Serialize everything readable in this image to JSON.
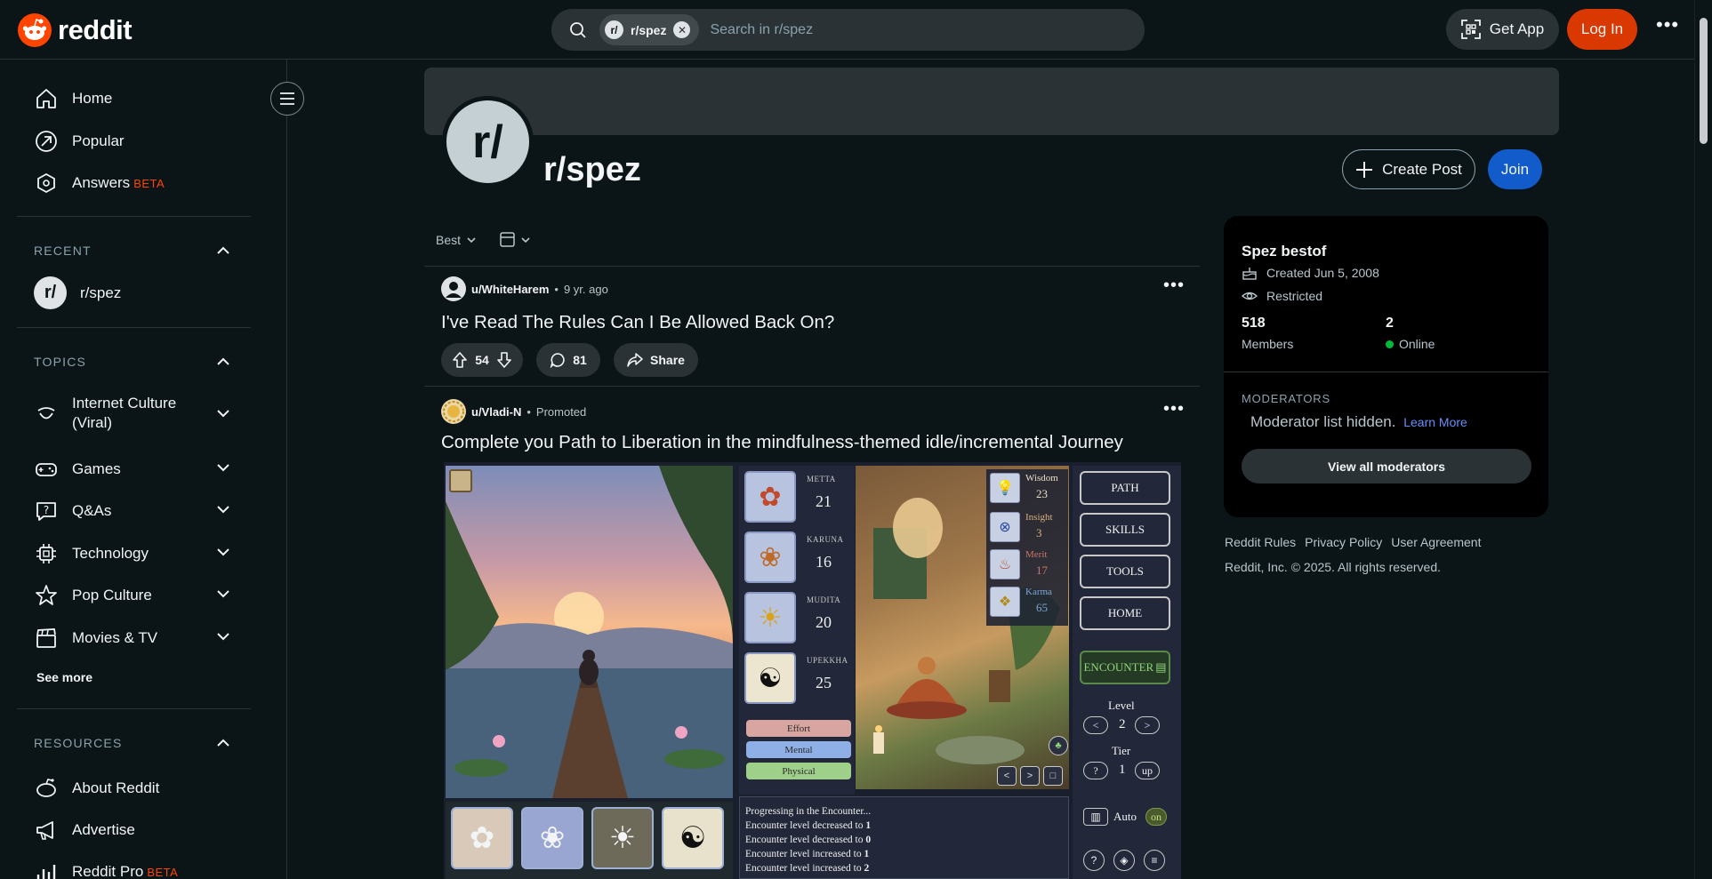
{
  "header": {
    "logo_text": "reddit",
    "search_chip": "r/spez",
    "search_chip_avatar": "r/",
    "search_placeholder": "Search in r/spez",
    "get_app": "Get App",
    "login": "Log In",
    "brand_color": "#ff4500",
    "login_color": "#d93900"
  },
  "sidebar": {
    "nav": [
      {
        "label": "Home",
        "icon": "home-icon"
      },
      {
        "label": "Popular",
        "icon": "popular-icon"
      },
      {
        "label": "Answers",
        "badge": "BETA",
        "icon": "answers-icon"
      }
    ],
    "recent_title": "RECENT",
    "recent": [
      {
        "label": "r/spez",
        "avatar": "r/"
      }
    ],
    "topics_title": "TOPICS",
    "topics": [
      {
        "label": "Internet Culture (Viral)",
        "icon": "smile-icon"
      },
      {
        "label": "Games",
        "icon": "gamepad-icon"
      },
      {
        "label": "Q&As",
        "icon": "question-icon"
      },
      {
        "label": "Technology",
        "icon": "chip-icon"
      },
      {
        "label": "Pop Culture",
        "icon": "star-icon"
      },
      {
        "label": "Movies & TV",
        "icon": "clapper-icon"
      }
    ],
    "see_more": "See more",
    "resources_title": "RESOURCES",
    "resources": [
      {
        "label": "About Reddit",
        "icon": "alien-icon"
      },
      {
        "label": "Advertise",
        "icon": "megaphone-icon"
      },
      {
        "label": "Reddit Pro",
        "badge": "BETA",
        "icon": "chart-icon"
      }
    ]
  },
  "community": {
    "avatar": "r/",
    "name": "r/spez",
    "create_post": "Create Post",
    "join": "Join"
  },
  "sort": {
    "label": "Best"
  },
  "posts": [
    {
      "user": "u/WhiteHarem",
      "time": "9 yr. ago",
      "title": "I've Read The Rules Can I Be Allowed Back On?",
      "votes": "54",
      "comments": "81",
      "share": "Share"
    },
    {
      "user": "u/Vladi-N",
      "promoted": "Promoted",
      "title": "Complete you Path to Liberation in the mindfulness-themed idle/incremental Journey"
    }
  ],
  "game": {
    "stats": [
      {
        "label": "METTA",
        "value": "21",
        "icon": "heart-flower-icon"
      },
      {
        "label": "KARUNA",
        "value": "16",
        "icon": "lotus-icon"
      },
      {
        "label": "MUDITA",
        "value": "20",
        "icon": "sun-icon"
      },
      {
        "label": "UPEKKHA",
        "value": "25",
        "icon": "yin-yang-icon"
      }
    ],
    "bars": [
      "Effort",
      "Mental",
      "Physical"
    ],
    "resources": [
      {
        "label": "Wisdom",
        "value": "23",
        "color": "#e8e0c8"
      },
      {
        "label": "Insight",
        "value": "3",
        "color": "#d6b07a"
      },
      {
        "label": "Merit",
        "value": "17",
        "color": "#c9756a"
      },
      {
        "label": "Karma",
        "value": "65",
        "color": "#7aa6d6"
      }
    ],
    "nav": [
      "PATH",
      "SKILLS",
      "TOOLS",
      "HOME"
    ],
    "encounter": "ENCOUNTER",
    "level_label": "Level",
    "level_value": "2",
    "tier_label": "Tier",
    "tier_value": "1",
    "tier_q": "?",
    "tier_up": "up",
    "auto_label": "Auto",
    "auto_state": "on",
    "log": [
      {
        "text": "Progressing in the Encounter...",
        "num": ""
      },
      {
        "text": "Encounter level decreased to ",
        "num": "1"
      },
      {
        "text": "Encounter level decreased to ",
        "num": "0"
      },
      {
        "text": "Encounter level increased to ",
        "num": "1"
      },
      {
        "text": "Encounter level increased to ",
        "num": "2"
      }
    ]
  },
  "about": {
    "title": "Spez bestof",
    "created": "Created Jun 5, 2008",
    "restricted": "Restricted",
    "members_count": "518",
    "members_label": "Members",
    "online_count": "2",
    "online_label": "Online",
    "moderators_title": "MODERATORS",
    "moderators_text": "Moderator list hidden.",
    "learn_more": "Learn More",
    "view_all": "View all moderators"
  },
  "footer": {
    "links": [
      "Reddit Rules",
      "Privacy Policy",
      "User Agreement"
    ],
    "copyright": "Reddit, Inc. © 2025. All rights reserved."
  }
}
